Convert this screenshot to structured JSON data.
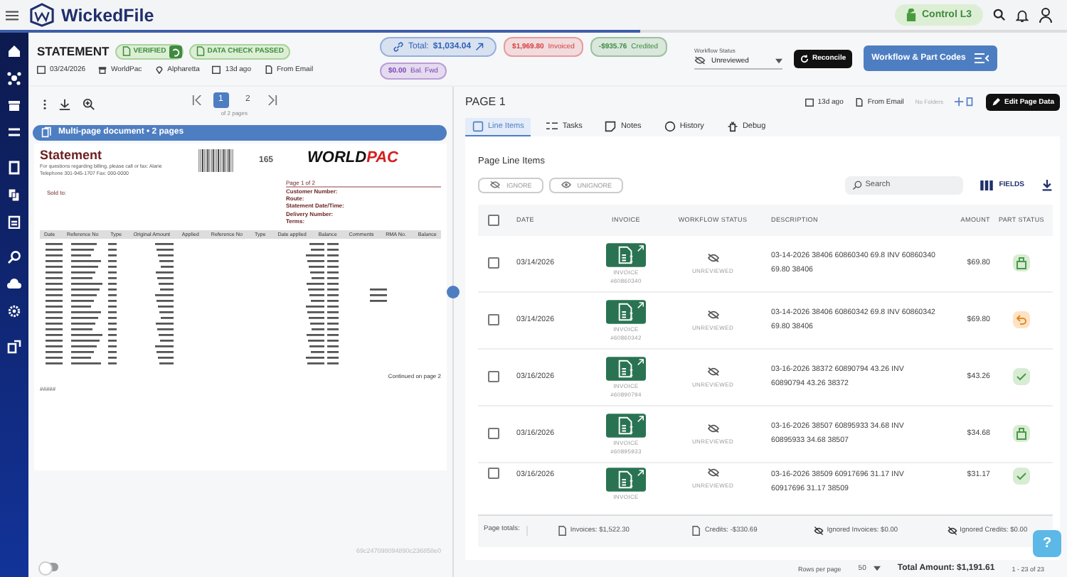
{
  "app": {
    "name": "WickedFile",
    "control": "Control L3"
  },
  "document": {
    "title": "STATEMENT",
    "badges": [
      {
        "label": "VERIFIED",
        "kind": "verified"
      },
      {
        "label": "DATA CHECK PASSED",
        "kind": "check"
      }
    ],
    "meta": [
      {
        "kind": "date",
        "text": "03/24/2026"
      },
      {
        "kind": "vendor",
        "text": "WorldPac"
      },
      {
        "kind": "place",
        "text": "Alpharetta"
      },
      {
        "kind": "age",
        "text": "13d ago"
      },
      {
        "kind": "source",
        "text": "From Email"
      }
    ],
    "chips": [
      {
        "kind": "total",
        "label": "Total:",
        "value": "$1,034.04",
        "color": "#2f62b8"
      },
      {
        "kind": "plain",
        "value": "$1,969.80",
        "label": "Invoiced",
        "color": "#d63b3b"
      },
      {
        "kind": "plain",
        "value": "-$935.76",
        "label": "Credited",
        "color": "#3b8a3b"
      },
      {
        "kind": "plain",
        "value": "$0.00",
        "label": "Bal. Fwd",
        "color": "#7d3fb5"
      }
    ],
    "workflow_status": {
      "label": "Workflow Status",
      "value": "Unreviewed"
    },
    "buttons": [
      "Reconcile",
      "Workflow & Part Codes"
    ]
  },
  "viewer": {
    "pages": [
      {
        "label": "1",
        "selected": true
      },
      {
        "label": "2",
        "selected": false
      }
    ],
    "page_count": "of 2 pages",
    "banner": "Multi-page document • 2 pages",
    "scan": {
      "title": "Statement",
      "note": "For questions regarding billing, please call or fax: Alarie     Telephone 301-945-1707 Fax:    000-0000",
      "number": "165",
      "logo_a": "WORLD",
      "logo_b": "PAC",
      "sold_to": "Sold to:",
      "page": "Page 1 of 2",
      "fields": [
        "Customer Number:",
        "Route:",
        "Statement Date/Time:",
        "Delivery Number:",
        "Terms:"
      ],
      "columns": [
        "Date",
        "Reference No",
        "Type",
        "Original Amount",
        "Applied",
        "Reference No",
        "Type",
        "Date applied",
        "Balance",
        "Comments",
        "RMA No.",
        "Balance"
      ],
      "continued": "Continued on page 2",
      "footer": "#####"
    },
    "doc_id": "69c247098094890c236858e0",
    "toggle": {
      "on": false
    }
  },
  "page": {
    "title": "PAGE 1",
    "age": "13d ago",
    "source": "From Email",
    "folders": "No Folders",
    "edit": "Edit Page Data",
    "tabs": [
      {
        "label": "Line Items",
        "selected": true,
        "kind": "items"
      },
      {
        "label": "Tasks",
        "selected": false,
        "kind": "tasks"
      },
      {
        "label": "Notes",
        "selected": false,
        "kind": "notes"
      },
      {
        "label": "History",
        "selected": false,
        "kind": "history"
      },
      {
        "label": "Debug",
        "selected": false,
        "kind": "debug"
      }
    ],
    "section": "Page Line Items",
    "ignore": "IGNORE",
    "unignore": "UNIGNORE",
    "search": {
      "placeholder": "Search"
    },
    "fields": "FIELDS",
    "select_all": {
      "checked": false
    },
    "columns": [
      "DATE",
      "INVOICE",
      "WORKFLOW STATUS",
      "DESCRIPTION",
      "AMOUNT",
      "PART STATUS"
    ],
    "rows": [
      {
        "checked": false,
        "date": "03/14/2026",
        "invoice": "INVOICE",
        "number": "#60860340",
        "status": "UNREVIEWED",
        "description": "03-14-2026 38406 60860340 69.8 INV 60860340 69.80 38406",
        "amount": "$69.80",
        "kind": "box"
      },
      {
        "checked": false,
        "date": "03/14/2026",
        "invoice": "INVOICE",
        "number": "#60860342",
        "status": "UNREVIEWED",
        "description": "03-14-2026 38406 60860342 69.8 INV 60860342 69.80 38406",
        "amount": "$69.80",
        "kind": "return"
      },
      {
        "checked": false,
        "date": "03/16/2026",
        "invoice": "INVOICE",
        "number": "#60890794",
        "status": "UNREVIEWED",
        "description": "03-16-2026 38372 60890794 43.26 INV 60890794 43.26 38372",
        "amount": "$43.26",
        "kind": "check"
      },
      {
        "checked": false,
        "date": "03/16/2026",
        "invoice": "INVOICE",
        "number": "#60895933",
        "status": "UNREVIEWED",
        "description": "03-16-2026 38507 60895933 34.68 INV 60895933 34.68 38507",
        "amount": "$34.68",
        "kind": "box"
      },
      {
        "checked": false,
        "date": "03/16/2026",
        "invoice": "INVOICE",
        "status": "UNREVIEWED",
        "description": "03-16-2026 38509 60917696 31.17 INV 60917696 31.17 38509",
        "amount": "$31.17",
        "kind": "check"
      }
    ],
    "totals_label": "Page totals:",
    "totals": [
      {
        "kind": "doc",
        "text": "Invoices: $1,522.30"
      },
      {
        "kind": "doc",
        "text": "Credits: -$330.69"
      },
      {
        "kind": "hidden",
        "text": "Ignored Invoices: $0.00"
      },
      {
        "kind": "hidden",
        "text": "Ignored Credits: $0.00"
      }
    ],
    "rows_per_page": "Rows per page",
    "page_size": "50",
    "total_amount": "Total Amount: $1,191.61",
    "range": "1 - 23 of 23",
    "help": "?"
  }
}
